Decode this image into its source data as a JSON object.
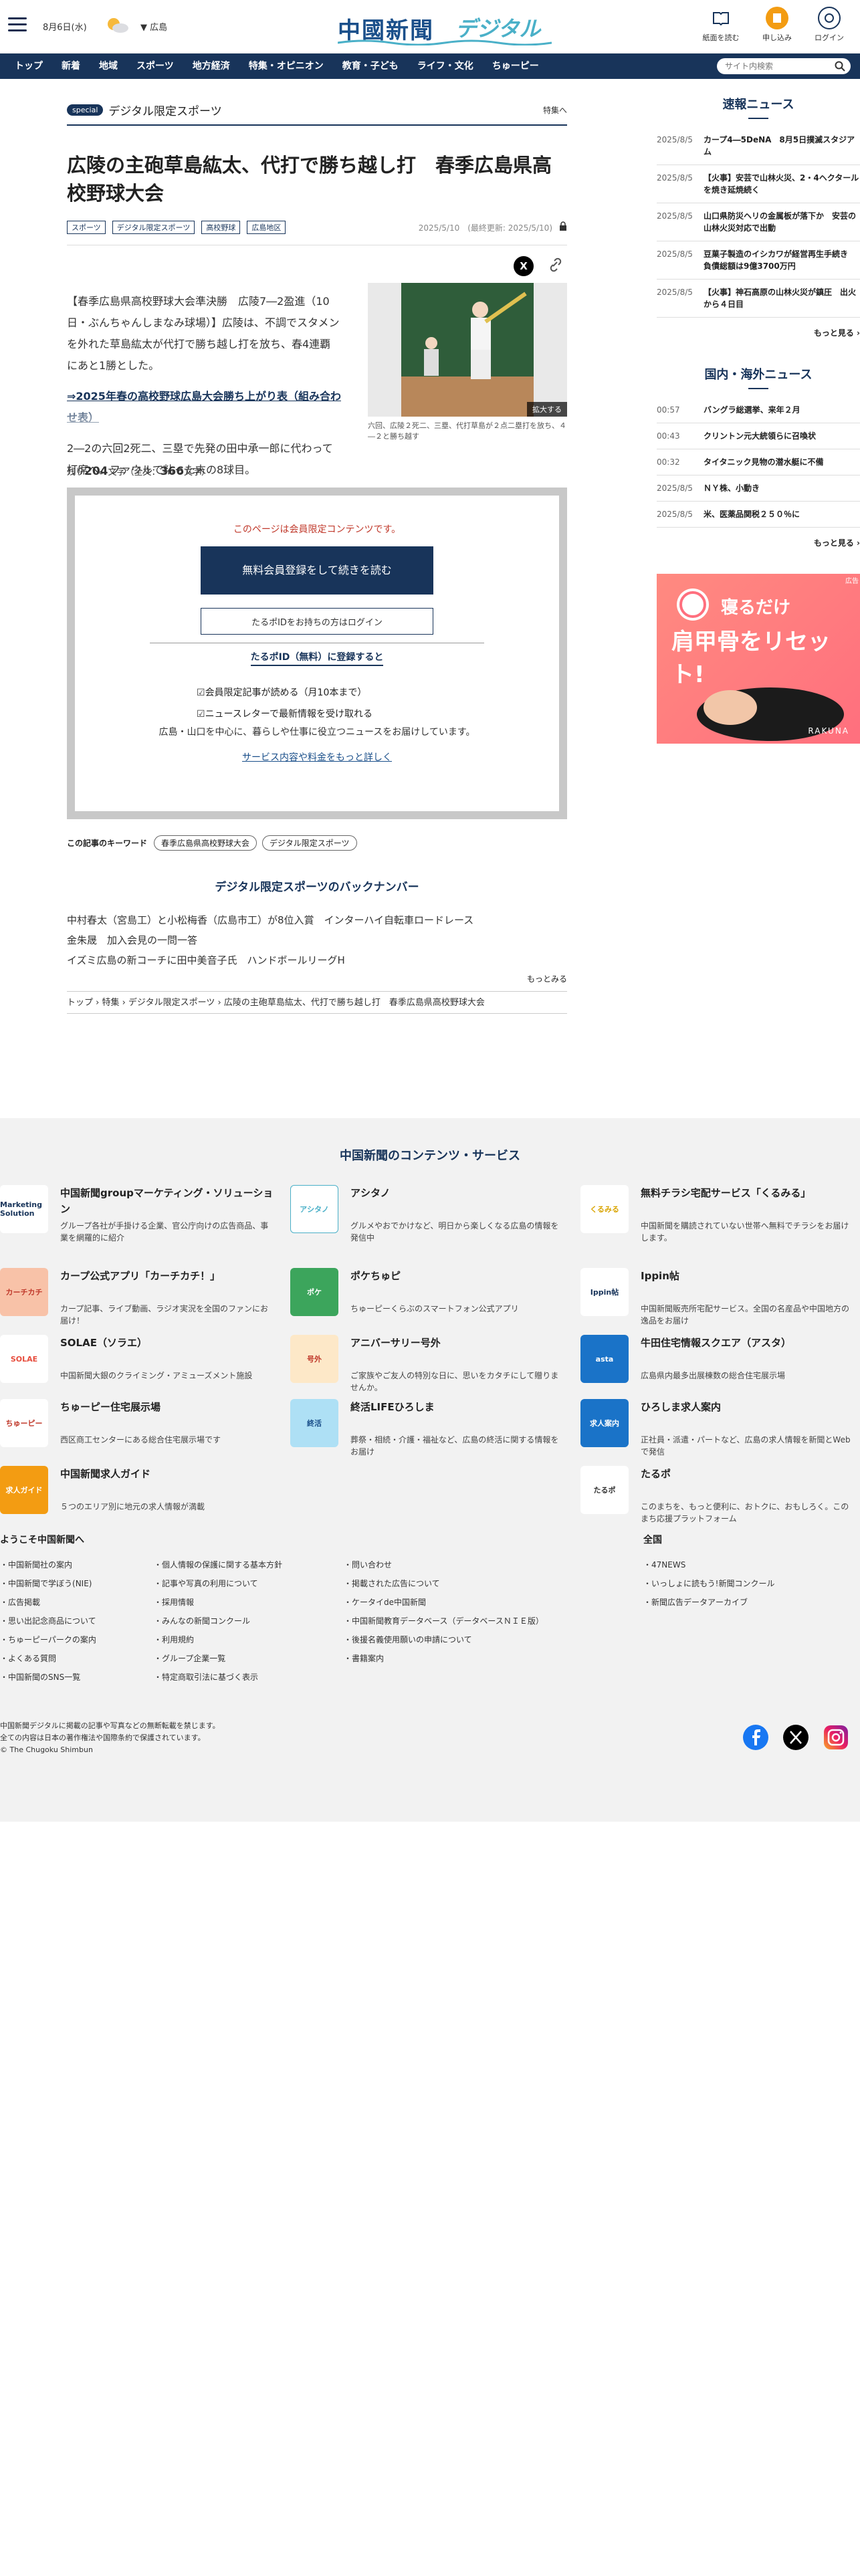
{
  "header": {
    "date": "8月6日(水)",
    "pref": "広島",
    "logo_main": "中國新聞",
    "logo_sub": "デジタル",
    "btn_paper": "紙面を読む",
    "btn_subscribe": "申し込み",
    "btn_login": "ログイン"
  },
  "nav": {
    "items": [
      "トップ",
      "新着",
      "地域",
      "スポーツ",
      "地方経済",
      "特集・オピニオン",
      "教育・子ども",
      "ライフ・文化",
      "ちゅーピー"
    ],
    "search_placeholder": "サイト内検索"
  },
  "section": {
    "badge": "special",
    "title": "デジタル限定スポーツ",
    "link": "特集へ"
  },
  "article": {
    "title": "広陵の主砲草島紘太、代打で勝ち越し打　春季広島県高校野球大会",
    "tags": [
      "スポーツ",
      "デジタル限定スポーツ",
      "高校野球",
      "広島地区"
    ],
    "date": "2025/5/10　(最終更新: 2025/5/10)",
    "lead": "【春季広島県高校野球大会準決勝　広陵7―2盈進（10日・ぶんちゃんしまなみ球場）】広陵は、不調でスタメンを外れた草島紘太が代打で勝ち越し打を放ち、春4連覇にあと1勝とした。",
    "link": "⇒2025年春の高校野球広島大会勝ち上がり表（組み合わせ表）",
    "more": "2―2の六回2死二、三塁で先発の田中承一郎に代わって打席へ。ファウルで粘った末の8球目。",
    "photo_enlarge": "拡大する",
    "photo_caption": "六回、広陵２死二、三塁、代打草島が２点二塁打を放ち、４―２と勝ち越す",
    "remain_label": "残り",
    "remain_count": "204",
    "remain_unit": "文字（全文：",
    "total_count": "366",
    "total_unit": "文字）"
  },
  "paywall": {
    "note": "このページは会員限定コンテンツです。",
    "btn_register": "無料会員登録をして続きを読む",
    "btn_login": "たるポIDをお持ちの方はログイン",
    "heading": "たるポID（無料）に登録すると",
    "benefits": [
      "会員限定記事が読める（月10本まで）",
      "ニュースレターで最新情報を受け取れる"
    ],
    "desc": "広島・山口を中心に、暮らしや仕事に役立つニュースをお届けしています。",
    "more": "サービス内容や料金をもっと詳しく"
  },
  "keywords": {
    "label": "この記事のキーワード",
    "items": [
      "春季広島県高校野球大会",
      "デジタル限定スポーツ"
    ]
  },
  "backnumber": {
    "heading": "デジタル限定スポーツのバックナンバー",
    "items": [
      "中村春太（宮島工）と小松梅香（広島市工）が8位入賞　インターハイ自転車ロードレース",
      "金朱晟　加入会見の一問一答",
      "イズミ広島の新コーチに田中美音子氏　ハンドボールリーグH"
    ],
    "more": "もっとみる"
  },
  "breadcrumb": "トップ › 特集 › デジタル限定スポーツ › 広陵の主砲草島紘太、代打で勝ち越し打　春季広島県高校野球大会",
  "sidebar": {
    "breaking_title": "速報ニュース",
    "breaking": [
      {
        "t": "2025/8/5",
        "title": "カープ4―5DeNA　8月5日撲滅スタジアム"
      },
      {
        "t": "2025/8/5",
        "title": "【火事】安芸で山林火災、2・4ヘクタールを焼き延焼続く"
      },
      {
        "t": "2025/8/5",
        "title": "山口県防災ヘリの金属板が落下か　安芸の山林火災対応で出動"
      },
      {
        "t": "2025/8/5",
        "title": "豆菓子製造のイシカワが経営再生手続き　負債総額は9億3700万円"
      },
      {
        "t": "2025/8/5",
        "title": "【火事】神石高原の山林火災が鎮圧　出火から４日目"
      }
    ],
    "breaking_more": "もっと見る ›",
    "world_title": "国内・海外ニュース",
    "world": [
      {
        "t": "00:57",
        "title": "バングラ総選挙、来年２月"
      },
      {
        "t": "00:43",
        "title": "クリントン元大統領らに召喚状"
      },
      {
        "t": "00:32",
        "title": "タイタニック見物の潜水艇に不備"
      },
      {
        "t": "2025/8/5",
        "title": "ＮＹ株、小動き"
      },
      {
        "t": "2025/8/5",
        "title": "米、医薬品関税２５０％に"
      }
    ],
    "world_more": "もっと見る ›",
    "ad_mark": "広告",
    "ad_line1": "寝るだけ",
    "ad_line2": "肩甲骨をリセット!",
    "ad_brand": "RAKUNA"
  },
  "services": {
    "heading": "中国新聞のコンテンツ・サービス",
    "items": [
      {
        "name": "中国新聞groupマーケティング・ソリューション",
        "desc": "グループ各社が手掛ける企業、官公庁向けの広告商品、事業を網羅的に紹介",
        "icon": "Marketing Solution"
      },
      {
        "name": "アシタノ",
        "desc": "グルメやおでかけなど、明日から楽しくなる広島の情報を発信中",
        "icon": "アシタノ"
      },
      {
        "name": "無料チラシ宅配サービス「くるみる」",
        "desc": "中国新聞を購読されていない世帯へ無料でチラシをお届けします。",
        "icon": "くるみる"
      },
      {
        "name": "カープ公式アプリ「カーチカチ！」",
        "desc": "カープ記事、ライブ動画、ラジオ実況を全国のファンにお届け！",
        "icon": "カーチカチ"
      },
      {
        "name": "ポケちゅピ",
        "desc": "ちゅーピーくらぶのスマートフォン公式アプリ",
        "icon": "ポケ"
      },
      {
        "name": "Ippin帖",
        "desc": "中国新聞販売所宅配サービス。全国の名産品や中国地方の逸品をお届け",
        "icon": "Ippin帖"
      },
      {
        "name": "SOLAE（ソラエ）",
        "desc": "中国新聞大銀のクライミング・アミューズメント施設",
        "icon": "SOLAE"
      },
      {
        "name": "アニバーサリー号外",
        "desc": "ご家族やご友人の特別な日に、思いをカタチにして贈りませんか。",
        "icon": "号外"
      },
      {
        "name": "牛田住宅情報スクエア（アスタ）",
        "desc": "広島県内最多出展棟数の総合住宅展示場",
        "icon": "asta"
      },
      {
        "name": "ちゅーピー住宅展示場",
        "desc": "西区商工センターにある総合住宅展示場です",
        "icon": "ちゅーピー"
      },
      {
        "name": "終活LIFEひろしま",
        "desc": "葬祭・相続・介護・福祉など、広島の終活に関する情報をお届け",
        "icon": "終活"
      },
      {
        "name": "ひろしま求人案内",
        "desc": "正社員・派遣・パートなど、広島の求人情報を新聞とWebで発信",
        "icon": "求人案内"
      },
      {
        "name": "中国新聞求人ガイド",
        "desc": "５つのエリア別に地元の求人情報が満載",
        "icon": "求人ガイド"
      },
      {
        "name": "たるポ",
        "desc": "このまちを、もっと便利に、おトクに、おもしろく。このまち応援プラットフォーム",
        "icon": "たるポ"
      }
    ]
  },
  "footer": {
    "welcome_title": "ようこそ中国新聞へ",
    "col1": [
      "中国新聞社の案内",
      "中国新聞で学ぼう(NIE)",
      "広告掲載",
      "思い出記念商品について",
      "ちゅーピーパークの案内",
      "よくある質問",
      "中国新聞のSNS一覧"
    ],
    "col2": [
      "個人情報の保護に関する基本方針",
      "記事や写真の利用について",
      "採用情報",
      "みんなの新聞コンクール",
      "利用規約",
      "グループ企業一覧",
      "特定商取引法に基づく表示"
    ],
    "col3": [
      "問い合わせ",
      "掲載された広告について",
      "ケータイde中国新聞",
      "中国新聞教育データベース（データベースＮＩＥ版）",
      "後援名義使用願いの申請について",
      "書籍案内"
    ],
    "national_title": "全国",
    "col4": [
      "47NEWS",
      "いっしょに読もう!新聞コンクール",
      "新聞広告データアーカイブ"
    ],
    "copy1": "中国新聞デジタルに掲載の記事や写真などの無断転載を禁じます。",
    "copy2": "全ての内容は日本の著作権法や国際条約で保護されています。",
    "copy3": "© The Chugoku Shimbun"
  },
  "colors": {
    "navy": "#18345a",
    "accent": "#f39c12"
  }
}
